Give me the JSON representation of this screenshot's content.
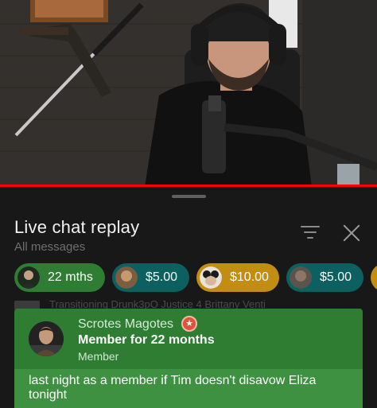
{
  "video": {
    "progress": 1.0,
    "colors": {
      "progress": "#ff0000"
    }
  },
  "chat": {
    "title": "Live chat replay",
    "subtitle": "All messages",
    "filter_icon": "filter-icon",
    "close_icon": "close-icon",
    "chips": [
      {
        "label": "22 mths",
        "bg": "#2e7d32",
        "avatar_color": "#3b3b3b"
      },
      {
        "label": "$5.00",
        "bg": "#0c6060",
        "avatar_color": "#8a6a4a"
      },
      {
        "label": "$10.00",
        "bg": "#c38d12",
        "avatar_color": "#d8d0c6"
      },
      {
        "label": "$5.00",
        "bg": "#0c6060",
        "avatar_color": "#6b6055"
      },
      {
        "label": "",
        "bg": "#c38d12",
        "avatar_color": "#c38d12"
      }
    ],
    "ticker": "Transitioning Drunk3pO   Justice 4 Brittany Venti",
    "pinned": {
      "author": "Scrotes Magotes",
      "badge_icon": "star-badge-icon",
      "duration": "Member for 22 months",
      "level": "Member",
      "message": "last night as a member if Tim doesn't disavow Eliza tonight",
      "colors": {
        "header": "#2e7d32",
        "body": "#3f9142",
        "badge": "#e0533a"
      }
    }
  }
}
